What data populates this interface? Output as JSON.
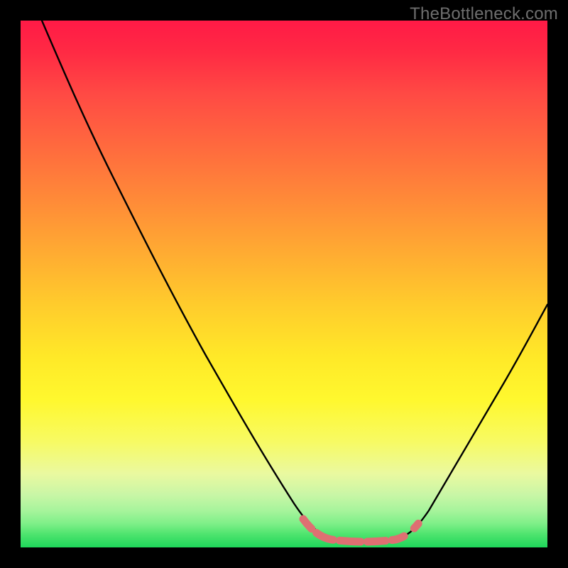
{
  "watermark": "TheBottleneck.com",
  "chart_data": {
    "type": "line",
    "title": "",
    "xlabel": "",
    "ylabel": "",
    "xlim": [
      0,
      100
    ],
    "ylim": [
      0,
      100
    ],
    "grid": false,
    "legend": false,
    "series": [
      {
        "name": "bottleneck-curve",
        "x": [
          4,
          10,
          20,
          30,
          40,
          50,
          55,
          58,
          60,
          62,
          65,
          68,
          70,
          72,
          75,
          80,
          85,
          90,
          95,
          100
        ],
        "values": [
          100,
          88,
          70,
          52,
          35,
          18,
          10,
          5,
          3,
          2,
          1.5,
          1.5,
          2,
          3,
          6,
          14,
          24,
          34,
          44,
          54
        ]
      }
    ],
    "highlight_band": {
      "name": "optimal-range",
      "x_start": 55,
      "x_end": 74,
      "y_approx": 2.5,
      "color": "#de6f72"
    },
    "gradient_stops": [
      {
        "pct": 0,
        "color": "#ff1a46"
      },
      {
        "pct": 24,
        "color": "#ff6a3e"
      },
      {
        "pct": 54,
        "color": "#ffcc2c"
      },
      {
        "pct": 72,
        "color": "#fff82e"
      },
      {
        "pct": 90,
        "color": "#c9f6a6"
      },
      {
        "pct": 100,
        "color": "#1ed65a"
      }
    ]
  }
}
